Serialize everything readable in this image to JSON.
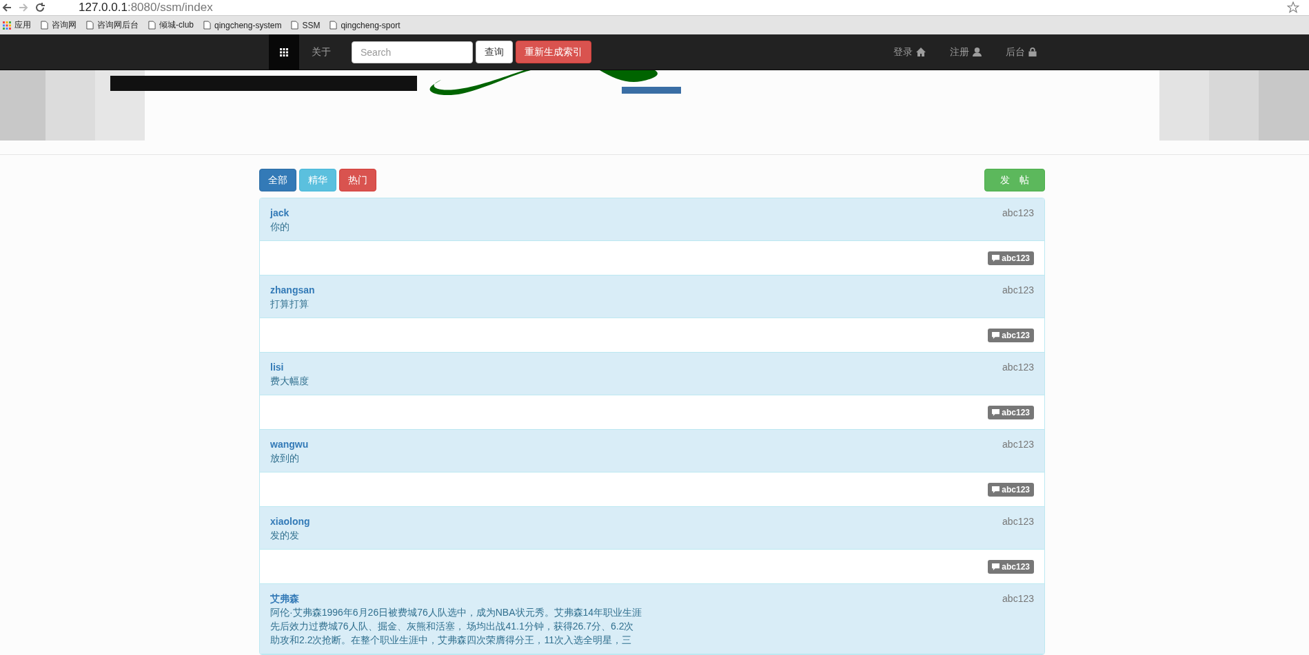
{
  "browser": {
    "url_host": "127.0.0.1",
    "url_rest": ":8080/ssm/index",
    "bookmarks": [
      "应用",
      "咨询网",
      "咨询网后台",
      "倾城-club",
      "qingcheng-system",
      "SSM",
      "qingcheng-sport"
    ]
  },
  "navbar": {
    "about": "关于",
    "search_placeholder": "Search",
    "search_button": "查询",
    "rebuild_button": "重新生成索引",
    "right_links": [
      {
        "label": "登录"
      },
      {
        "label": "注册"
      },
      {
        "label": "后台"
      }
    ]
  },
  "filters": [
    {
      "label": "全部",
      "kind": "primary"
    },
    {
      "label": "精华",
      "kind": "info"
    },
    {
      "label": "热门",
      "kind": "danger"
    }
  ],
  "post_button": "发　帖",
  "posts": [
    {
      "author": "jack",
      "content": "你的",
      "right": "abc123",
      "badge": "abc123"
    },
    {
      "author": "zhangsan",
      "content": "打算打算",
      "right": "abc123",
      "badge": "abc123"
    },
    {
      "author": "lisi",
      "content": "费大幅度",
      "right": "abc123",
      "badge": "abc123"
    },
    {
      "author": "wangwu",
      "content": "放到的",
      "right": "abc123",
      "badge": "abc123"
    },
    {
      "author": "xiaolong",
      "content": "发的发",
      "right": "abc123",
      "badge": "abc123"
    },
    {
      "author": "艾弗森",
      "content": "阿伦·艾弗森1996年6月26日被费城76人队选中，成为NBA状元秀。艾弗森14年职业生涯先后效力过费城76人队、掘金、灰熊和活塞， 场均出战41.1分钟，获得26.7分、6.2次助攻和2.2次抢断。在整个职业生涯中，艾弗森四次荣膺得分王，11次入选全明星，三",
      "right": "abc123"
    }
  ]
}
